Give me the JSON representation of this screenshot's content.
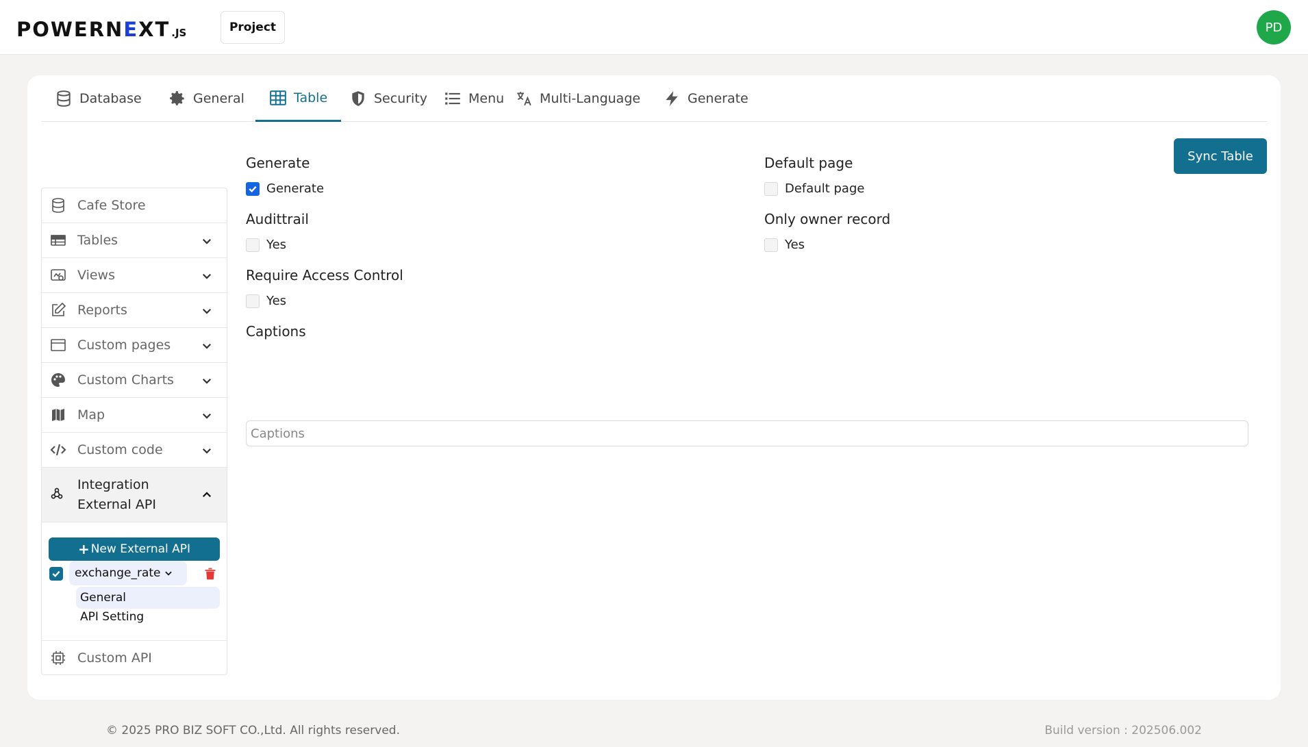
{
  "header": {
    "logo_main": "POWERN",
    "logo_e": "E",
    "logo_rest": "XT",
    "logo_suffix": ".JS",
    "project_label": "Project",
    "avatar_initials": "PD"
  },
  "tabs": [
    {
      "label": "Database",
      "icon": "database-icon",
      "active": false
    },
    {
      "label": "General",
      "icon": "gear-icon",
      "active": false
    },
    {
      "label": "Table",
      "icon": "table-icon",
      "active": true
    },
    {
      "label": "Security",
      "icon": "shield-icon",
      "active": false
    },
    {
      "label": "Menu",
      "icon": "list-icon",
      "active": false
    },
    {
      "label": "Multi-Language",
      "icon": "translate-icon",
      "active": false
    },
    {
      "label": "Generate",
      "icon": "bolt-icon",
      "active": false
    }
  ],
  "sync_button": "Sync Table",
  "sidebar": {
    "items": [
      {
        "label": "Cafe Store",
        "icon": "database-icon"
      },
      {
        "label": "Tables",
        "icon": "table-icon"
      },
      {
        "label": "Views",
        "icon": "view-icon"
      },
      {
        "label": "Reports",
        "icon": "edit-icon"
      },
      {
        "label": "Custom pages",
        "icon": "window-icon"
      },
      {
        "label": "Custom Charts",
        "icon": "palette-icon"
      },
      {
        "label": "Map",
        "icon": "map-icon"
      },
      {
        "label": "Custom code",
        "icon": "code-icon"
      }
    ],
    "integration_line1": "Integration",
    "integration_line2": "External API",
    "new_api_button": "New External API",
    "api_name": "exchange_rate",
    "sub_items": [
      "General",
      "API Setting"
    ],
    "custom_api": "Custom API"
  },
  "form": {
    "generate_label": "Generate",
    "generate_checkbox": "Generate",
    "default_page_label": "Default page",
    "default_page_checkbox": "Default page",
    "audittrail_label": "Audittrail",
    "audittrail_checkbox": "Yes",
    "only_owner_label": "Only owner record",
    "only_owner_checkbox": "Yes",
    "require_access_label": "Require Access Control",
    "require_access_checkbox": "Yes",
    "captions_label": "Captions",
    "captions_placeholder": "Captions"
  },
  "footer": {
    "copyright": "© 2025 PRO BIZ SOFT CO.,Ltd. All rights reserved.",
    "build": "Build version : 202506.002"
  },
  "colors": {
    "accent": "#136f8f",
    "checkbox_blue": "#1565e0",
    "avatar_green": "#1ea84a",
    "trash_red": "#e53935"
  }
}
